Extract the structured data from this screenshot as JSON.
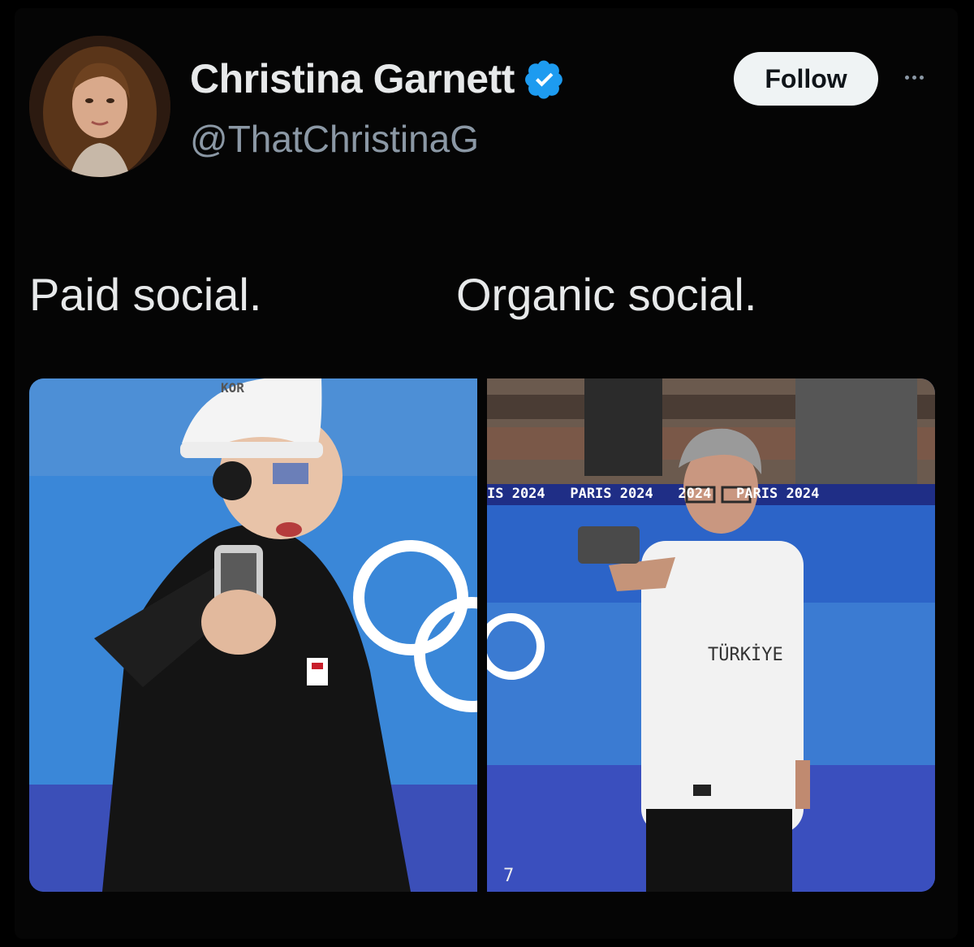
{
  "tweet": {
    "author_name": "Christina Garnett",
    "handle": "@ThatChristinaG",
    "follow_label": "Follow",
    "verified_icon": "verified-badge-icon",
    "more_icon": "more-options-icon"
  },
  "captions": {
    "left": "Paid social.",
    "right": "Organic social."
  },
  "photo_left": {
    "cap_text": "KOR"
  },
  "photo_right": {
    "banner_text": "IS 2024   PARIS 2024   2024   PARIS 2024",
    "shirt_text": "TÜRKİYE",
    "lane_number": "7"
  },
  "colors": {
    "background": "#000000",
    "verified_blue": "#1d9bf0",
    "follow_bg": "#eff3f4",
    "handle_gray": "#8b98a5"
  }
}
